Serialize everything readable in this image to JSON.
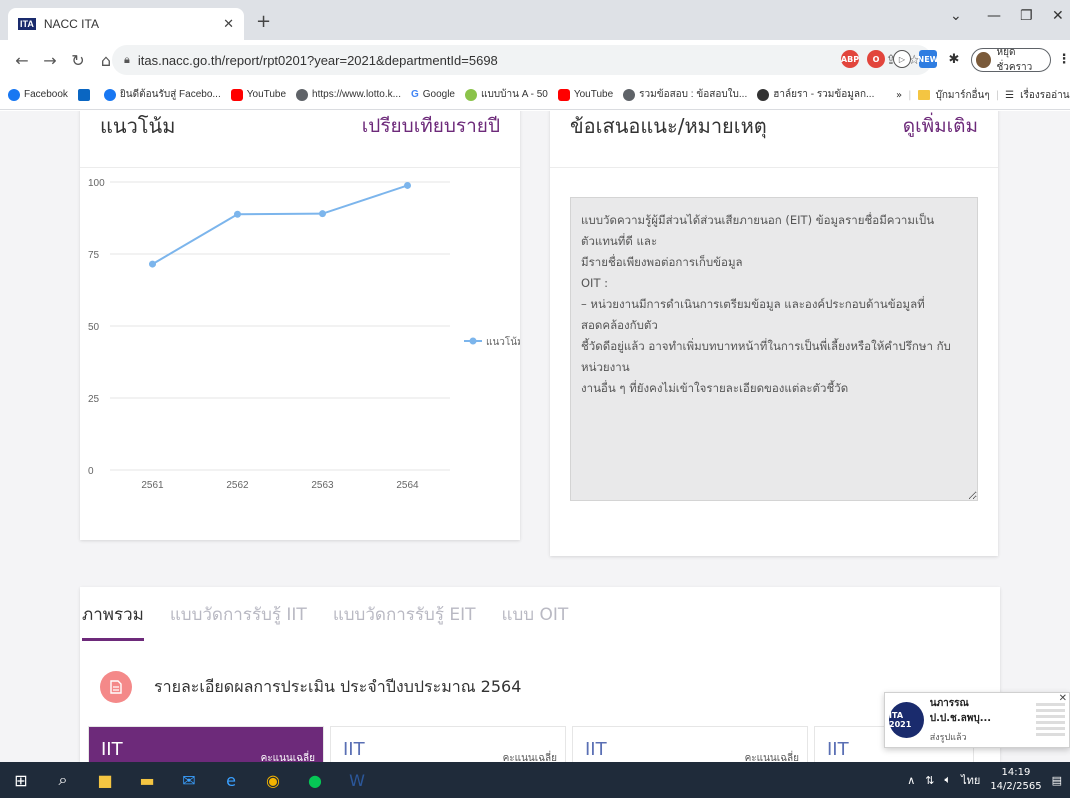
{
  "browser": {
    "tab": {
      "favicon_text": "ITA",
      "title": "NACC ITA"
    },
    "url": "itas.nacc.go.th/report/rpt0201?year=2021&departmentId=5698",
    "profile_label": "หยุดชั่วคราว",
    "extensions": [
      {
        "name": "abp-icon",
        "text": "ABP",
        "color": "#e2453c"
      },
      {
        "name": "opera-icon",
        "text": "O",
        "color": "#e2453c"
      },
      {
        "name": "new-icon",
        "text": "NEW",
        "color": "#2f7de1"
      }
    ]
  },
  "bookmarks": [
    {
      "label": "Facebook",
      "color": "#1877f2"
    },
    {
      "label": "",
      "color": "#0a66c2"
    },
    {
      "label": "ยินดีต้อนรับสู่ Facebo...",
      "color": "#1877f2"
    },
    {
      "label": "YouTube",
      "color": "#ff0000"
    },
    {
      "label": "https://www.lotto.k...",
      "color": "#5f6368"
    },
    {
      "label": "Google",
      "color": "#4285f4"
    },
    {
      "label": "แบบบ้าน A - 50",
      "color": "#8bc34a"
    },
    {
      "label": "YouTube",
      "color": "#ff0000"
    },
    {
      "label": "รวมข้อสอบ : ข้อสอบใบ...",
      "color": "#5f6368"
    },
    {
      "label": "ฮาล์ยรา - รวมข้อมูลก...",
      "color": "#333333"
    }
  ],
  "bookmarks_right": {
    "overflow": "»",
    "folder": "บุ๊กมาร์กอื่นๆ",
    "reading": "เรื่องรออ่าน"
  },
  "trend_card": {
    "title": "แนวโน้ม",
    "link": "เปรียบเทียบรายปี"
  },
  "chart_data": {
    "type": "line",
    "categories": [
      "2561",
      "2562",
      "2563",
      "2564"
    ],
    "series": [
      {
        "name": "แนวโน้ม",
        "values": [
          71.5,
          88.8,
          89.0,
          98.8
        ],
        "color": "#7cb5ec"
      }
    ],
    "yticks": [
      "100",
      "75",
      "50",
      "25",
      "0"
    ],
    "ylim": [
      0,
      100
    ],
    "legend": "right",
    "grid": true
  },
  "suggest_card": {
    "title": "ข้อเสนอแนะ/หมายเหตุ",
    "link": "ดูเพิ่มเติม",
    "text": "แบบวัดความรู้ผู้มีส่วนได้ส่วนเสียภายนอก (EIT) ข้อมูลรายชื่อมีความเป็นตัวแทนที่ดี และ\nมีรายชื่อเพียงพอต่อการเก็บข้อมูล\nOIT :\n– หน่วยงานมีการดำเนินการเตรียมข้อมูล และองค์ประกอบด้านข้อมูลที่สอดคล้องกับตัว\nชี้วัดดีอยู่แล้ว อาจทำเพิ่มบทบาทหน้าที่ในการเป็นพี่เลี้ยงหรือให้คำปรึกษา กับหน่วยงาน\nงานอื่น ๆ ที่ยังคงไม่เข้าใจรายละเอียดของแต่ละตัวชี้วัด"
  },
  "tabs": [
    "ภาพรวม",
    "แบบวัดการรับรู้ IIT",
    "แบบวัดการรับรู้ EIT",
    "แบบ OIT"
  ],
  "detail_title": "รายละเอียดผลการประเมิน ประจำปีงบประมาณ 2564",
  "score_boxes": [
    {
      "title": "IIT",
      "right": "คะแนนเฉลี่ย"
    },
    {
      "title": "IIT",
      "right": "คะแนนเฉลี่ย"
    },
    {
      "title": "IIT",
      "right": "คะแนนเฉลี่ย"
    },
    {
      "title": "IIT",
      "right": ""
    }
  ],
  "notification": {
    "logo_text": "ITA 2021",
    "title": "นภารรณ ป.ป.ช.ลพบุ...",
    "subtitle": "ส่งรูปแล้ว"
  },
  "taskbar": {
    "lang": "ไทย",
    "time": "14:19",
    "date": "14/2/2565"
  }
}
